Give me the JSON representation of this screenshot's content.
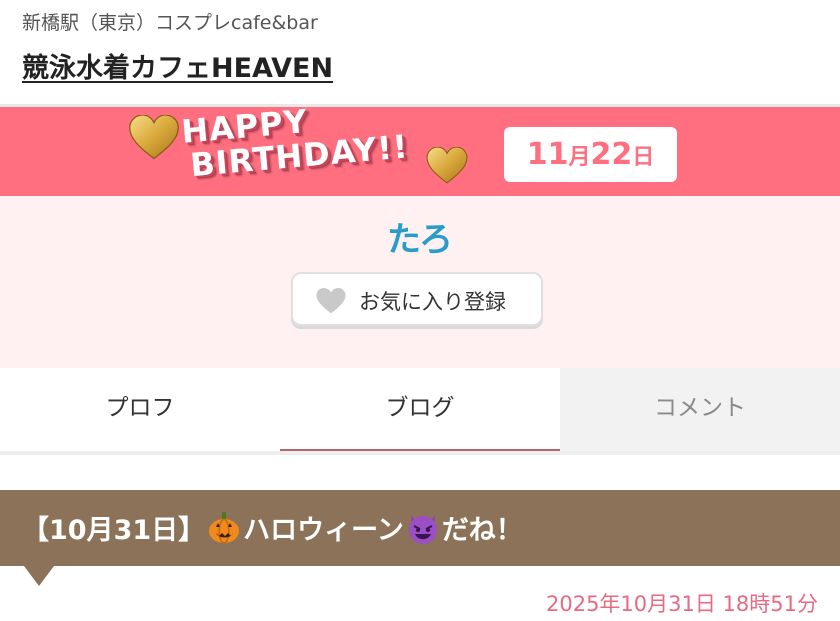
{
  "header": {
    "location": "新橋駅（東京）コスプレcafe&bar",
    "shop_name": "競泳水着カフェHEAVEN"
  },
  "birthday_banner": {
    "line1": "HAPPY",
    "line2": "BIRTHDAY!!",
    "date_month": "11",
    "date_month_unit": "月",
    "date_day": "22",
    "date_day_unit": "日"
  },
  "profile": {
    "name": "たろ",
    "favorite_label": "お気に入り登録"
  },
  "tabs": [
    {
      "label": "プロフ",
      "active": false
    },
    {
      "label": "ブログ",
      "active": true
    },
    {
      "label": "コメント",
      "active": false
    }
  ],
  "post": {
    "title_part1": "【10月31日】",
    "title_part2": "ハロウィーン",
    "title_part3": "だね！",
    "date": "2025年10月31日 18時51分",
    "emoji1": "pumpkin-icon",
    "emoji2": "smiling-devil-icon"
  },
  "colors": {
    "banner_pink": "#ff6f80",
    "profile_bg": "#fff1f2",
    "name_blue": "#2a9cc9",
    "post_brown": "#8b7259",
    "date_pink": "#e86a82",
    "active_tab_underline": "#b5676f"
  }
}
